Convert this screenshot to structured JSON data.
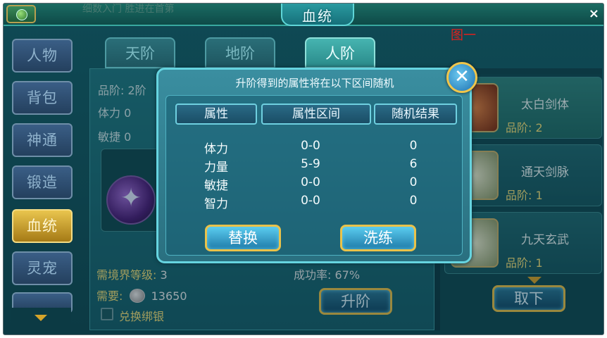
{
  "window": {
    "title": "血统",
    "close_symbol": "×",
    "faded_text": "细数入门 胜进在首第"
  },
  "annotation": "图一",
  "sidebar": {
    "items": [
      {
        "label": "人物"
      },
      {
        "label": "背包"
      },
      {
        "label": "神通"
      },
      {
        "label": "锻造"
      },
      {
        "label": "血统"
      },
      {
        "label": "灵宠"
      }
    ],
    "active": "血统"
  },
  "tabs": [
    {
      "label": "天阶"
    },
    {
      "label": "地阶"
    },
    {
      "label": "人阶"
    }
  ],
  "active_tab": "人阶",
  "stats": {
    "grade": "品阶: 2阶",
    "stamina": "体力 0",
    "agility": "敏捷 0"
  },
  "requirements": {
    "realm_label": "需境界等级:",
    "realm_value": "3",
    "cost_label": "需要:",
    "cost_value": "13650",
    "success_label": "成功率:",
    "success_value": "67%",
    "exchange_label": "兑换绑银"
  },
  "buttons": {
    "upgrade": "升阶",
    "remove": "取下"
  },
  "bloodlines": [
    {
      "name": "太白剑体",
      "grade": "品阶: 2"
    },
    {
      "name": "通天剑脉",
      "grade": "品阶: 1"
    },
    {
      "name": "九天玄武",
      "grade": "品阶: 1"
    }
  ],
  "dialog": {
    "header": "升阶得到的属性将在以下区间随机",
    "columns": [
      "属性",
      "属性区间",
      "随机结果"
    ],
    "rows": [
      {
        "attr": "体力",
        "range": "0-0",
        "result": "0"
      },
      {
        "attr": "力量",
        "range": "5-9",
        "result": "6"
      },
      {
        "attr": "敏捷",
        "range": "0-0",
        "result": "0"
      },
      {
        "attr": "智力",
        "range": "0-0",
        "result": "0"
      }
    ],
    "replace_label": "替换",
    "refine_label": "洗练",
    "close_symbol": "✕"
  }
}
